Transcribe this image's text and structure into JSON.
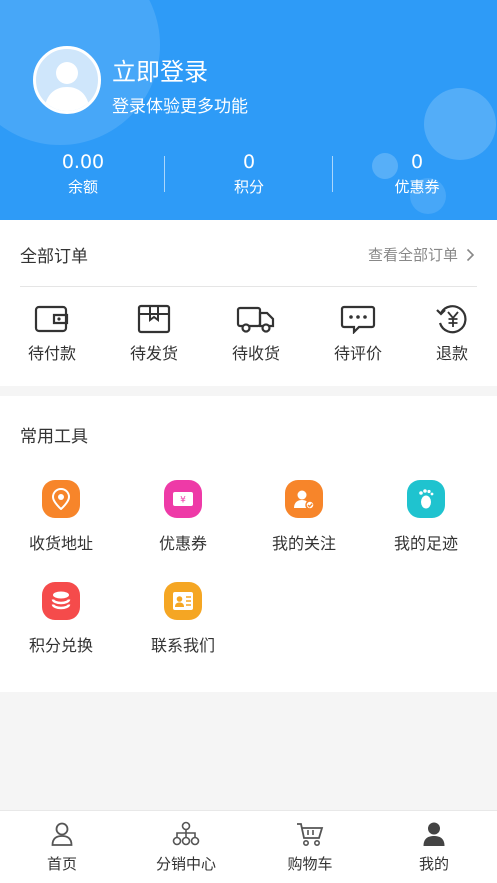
{
  "header": {
    "login_title": "立即登录",
    "login_subtitle": "登录体验更多功能",
    "stats": [
      {
        "value": "0.00",
        "label": "余额"
      },
      {
        "value": "0",
        "label": "积分"
      },
      {
        "value": "0",
        "label": "优惠券"
      }
    ],
    "accent_color": "#2e9bf7"
  },
  "orders": {
    "title": "全部订单",
    "view_all": "查看全部订单",
    "items": [
      {
        "label": "待付款",
        "icon": "wallet-icon"
      },
      {
        "label": "待发货",
        "icon": "box-icon"
      },
      {
        "label": "待收货",
        "icon": "truck-icon"
      },
      {
        "label": "待评价",
        "icon": "comment-icon"
      },
      {
        "label": "退款",
        "icon": "refund-icon"
      }
    ]
  },
  "tools": {
    "title": "常用工具",
    "items": [
      {
        "label": "收货地址",
        "icon": "location-icon",
        "color": "#f7852a"
      },
      {
        "label": "优惠券",
        "icon": "coupon-icon",
        "color": "#ee3aa7"
      },
      {
        "label": "我的关注",
        "icon": "follow-icon",
        "color": "#f7852a"
      },
      {
        "label": "我的足迹",
        "icon": "footprint-icon",
        "color": "#1fc3cf"
      },
      {
        "label": "积分兑换",
        "icon": "points-icon",
        "color": "#f54b4b"
      },
      {
        "label": "联系我们",
        "icon": "contact-icon",
        "color": "#f5a623"
      }
    ]
  },
  "tabbar": {
    "items": [
      {
        "label": "首页",
        "icon": "home-icon"
      },
      {
        "label": "分销中心",
        "icon": "distribution-icon"
      },
      {
        "label": "购物车",
        "icon": "cart-icon"
      },
      {
        "label": "我的",
        "icon": "user-icon"
      }
    ]
  }
}
